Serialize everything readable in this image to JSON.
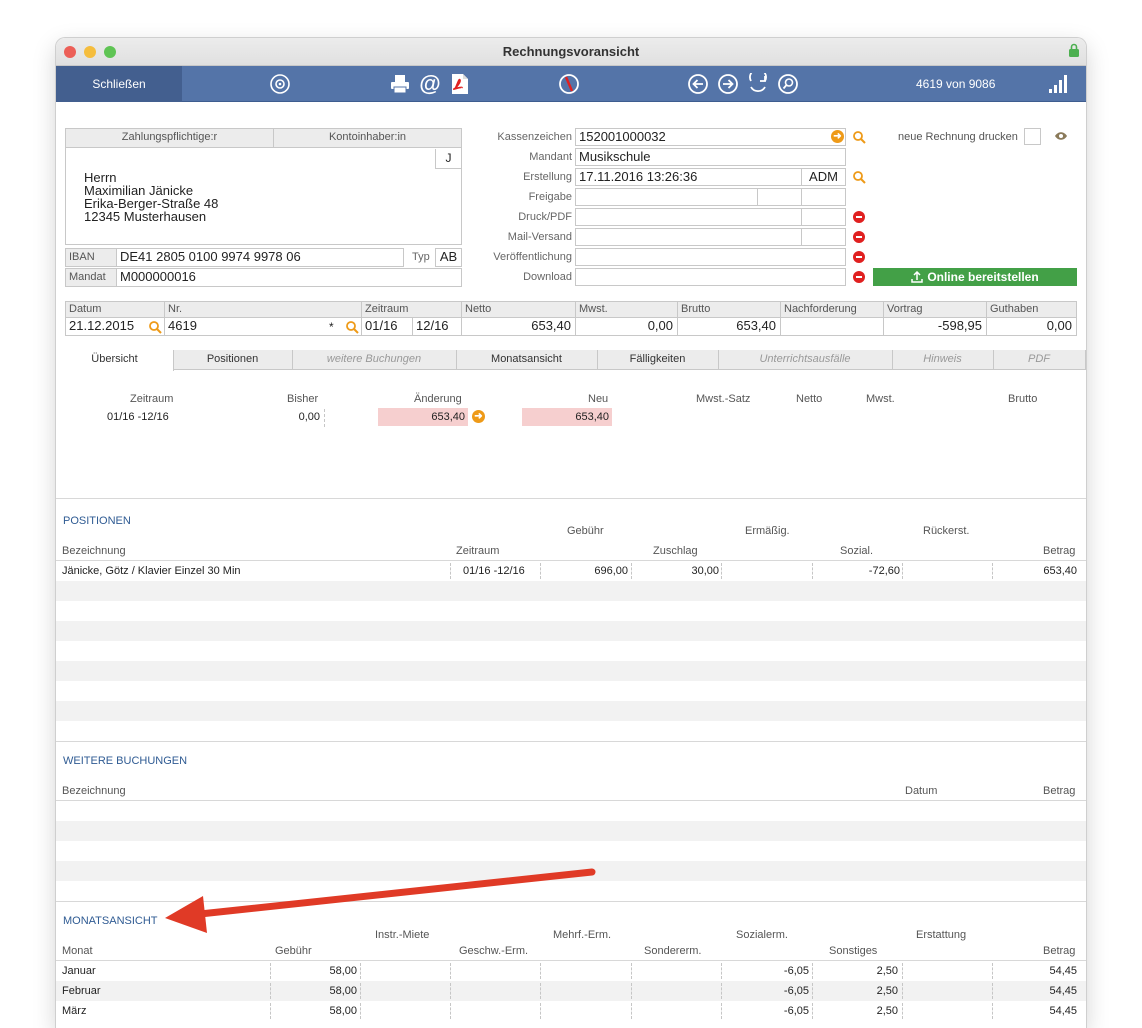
{
  "window": {
    "title": "Rechnungsvoransicht"
  },
  "toolbar": {
    "close_label": "Schließen",
    "counter": "4619 von 9086"
  },
  "address": {
    "tab_payer": "Zahlungspflichtige:r",
    "tab_holder": "Kontoinhaber:in",
    "j_flag": "J",
    "lines": [
      "Herrn",
      "Maximilian Jänicke",
      "Erika-Berger-Straße 48",
      "12345 Musterhausen"
    ],
    "iban_label": "IBAN",
    "iban": "DE41 2805 0100 9974 9978 06",
    "typ_label": "Typ",
    "typ": "AB",
    "mandat_label": "Mandat",
    "mandat": "M000000016"
  },
  "fields": {
    "kassenzeichen_label": "Kassenzeichen",
    "kassenzeichen": "152001000032",
    "mandant_label": "Mandant",
    "mandant": "Musikschule",
    "erstellung_label": "Erstellung",
    "erstellung": "17.11.2016 13:26:36",
    "erstellung_user": "ADM",
    "freigabe_label": "Freigabe",
    "druck_label": "Druck/PDF",
    "mail_label": "Mail-Versand",
    "veroeff_label": "Veröffentlichung",
    "download_label": "Download",
    "neue_rechnung_label": "neue Rechnung drucken",
    "online_label": "Online bereitstellen"
  },
  "summary": {
    "headers": [
      "Datum",
      "Nr.",
      "Zeitraum",
      "Netto",
      "Mwst.",
      "Brutto",
      "Nachforderung",
      "Vortrag",
      "Guthaben"
    ],
    "datum": "21.12.2015",
    "nr": "4619",
    "nr_star": "*",
    "zeitraum_from": "01/16",
    "zeitraum_to": "12/16",
    "netto": "653,40",
    "mwst": "0,00",
    "brutto": "653,40",
    "nachforderung": "",
    "vortrag": "-598,95",
    "guthaben": "0,00"
  },
  "tabs": [
    "Übersicht",
    "Positionen",
    "weitere Buchungen",
    "Monatsansicht",
    "Fälligkeiten",
    "Unterrichtsausfälle",
    "Hinweis",
    "PDF"
  ],
  "overview": {
    "headers": [
      "Zeitraum",
      "Bisher",
      "Änderung",
      "Neu",
      "Mwst.-Satz",
      "Netto",
      "Mwst.",
      "Brutto"
    ],
    "zeitraum": "01/16 -12/16",
    "bisher": "0,00",
    "aenderung": "653,40",
    "neu": "653,40"
  },
  "positionen": {
    "title": "POSITIONEN",
    "headers_top": [
      "Gebühr",
      "Ermäßig.",
      "Rückerst."
    ],
    "headers": [
      "Bezeichnung",
      "Zeitraum",
      "Zuschlag",
      "Sozial.",
      "Betrag"
    ],
    "rows": [
      {
        "bez": "Jänicke, Götz / Klavier Einzel 30 Min",
        "zeitraum": "01/16 -12/16",
        "gebuehr": "696,00",
        "zuschlag": "30,00",
        "ermaessig": "",
        "sozial": "-72,60",
        "rueck": "",
        "betrag": "653,40"
      }
    ]
  },
  "weitere": {
    "title": "WEITERE BUCHUNGEN",
    "headers": [
      "Bezeichnung",
      "Datum",
      "Betrag"
    ]
  },
  "monat": {
    "title": "MONATSANSICHT",
    "headers_top": [
      "Instr.-Miete",
      "Mehrf.-Erm.",
      "Sozialerm.",
      "Erstattung"
    ],
    "headers": [
      "Monat",
      "Gebühr",
      "Geschw.-Erm.",
      "Sondererm.",
      "Sonstiges",
      "Betrag"
    ],
    "rows": [
      {
        "monat": "Januar",
        "gebuehr": "58,00",
        "sozial": "-6,05",
        "sonst": "2,50",
        "betrag": "54,45"
      },
      {
        "monat": "Februar",
        "gebuehr": "58,00",
        "sozial": "-6,05",
        "sonst": "2,50",
        "betrag": "54,45"
      },
      {
        "monat": "März",
        "gebuehr": "58,00",
        "sozial": "-6,05",
        "sonst": "2,50",
        "betrag": "54,45"
      }
    ]
  },
  "colors": {
    "toolbar": "#5474a8",
    "accent": "#2f5b93",
    "highlight": "#f6cfcf",
    "online_btn": "#43a047",
    "annotation_arrow": "#e03a26"
  },
  "icons": [
    "gear-icon",
    "printer-icon",
    "at-icon",
    "pdf-icon",
    "no-entry-icon",
    "arrow-left-icon",
    "arrow-right-icon",
    "refresh-icon",
    "search-icon",
    "signal-icon",
    "lock-icon",
    "eye-icon",
    "upload-icon"
  ]
}
